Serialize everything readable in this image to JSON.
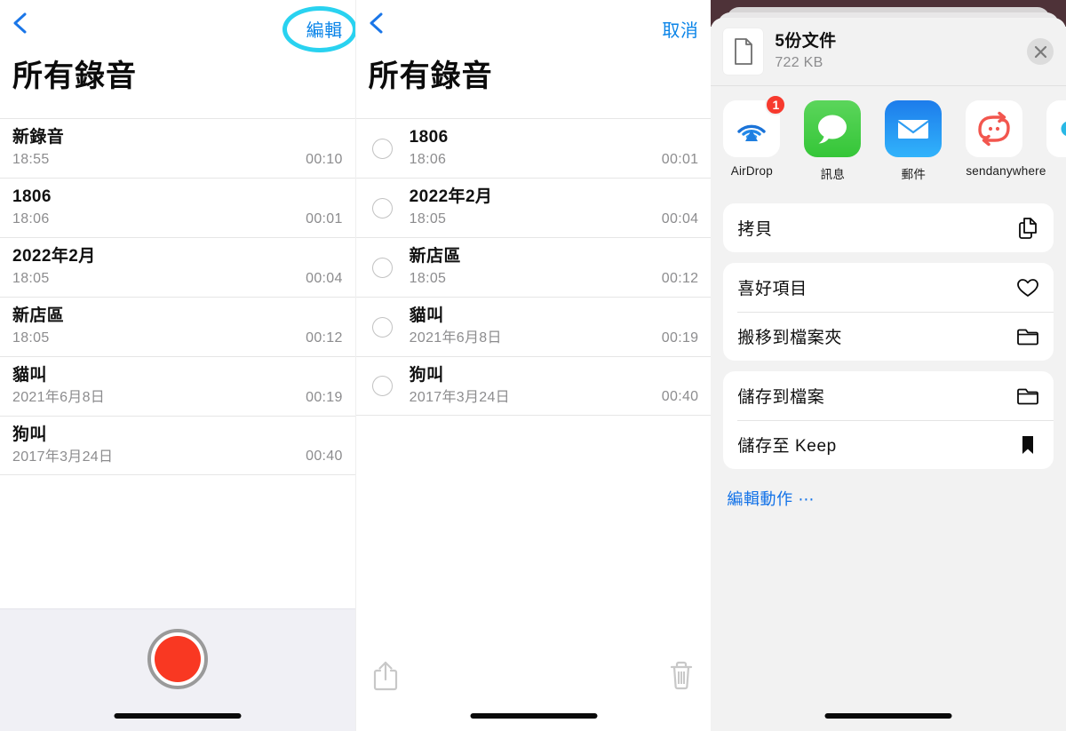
{
  "panel1": {
    "nav": {
      "back_icon": "chevron-left-icon",
      "edit_label": "編輯"
    },
    "title": "所有錄音",
    "recordings": [
      {
        "name": "新錄音",
        "date": "18:55",
        "duration": "00:10"
      },
      {
        "name": "1806",
        "date": "18:06",
        "duration": "00:01"
      },
      {
        "name": "2022年2月",
        "date": "18:05",
        "duration": "00:04"
      },
      {
        "name": "新店區",
        "date": "18:05",
        "duration": "00:12"
      },
      {
        "name": "貓叫",
        "date": "2021年6月8日",
        "duration": "00:19"
      },
      {
        "name": "狗叫",
        "date": "2017年3月24日",
        "duration": "00:40"
      }
    ],
    "record_button_icon": "record-circle-icon"
  },
  "panel2": {
    "nav": {
      "back_icon": "chevron-left-icon",
      "cancel_label": "取消"
    },
    "title": "所有錄音",
    "recordings": [
      {
        "name": "1806",
        "date": "18:06",
        "duration": "00:01"
      },
      {
        "name": "2022年2月",
        "date": "18:05",
        "duration": "00:04"
      },
      {
        "name": "新店區",
        "date": "18:05",
        "duration": "00:12"
      },
      {
        "name": "貓叫",
        "date": "2021年6月8日",
        "duration": "00:19"
      },
      {
        "name": "狗叫",
        "date": "2017年3月24日",
        "duration": "00:40"
      }
    ],
    "toolbar": {
      "share_icon": "share-up-arrow-icon",
      "trash_icon": "trash-icon"
    }
  },
  "panel3": {
    "header": {
      "doc_icon": "document-icon",
      "title": "5份文件",
      "size": "722 KB",
      "close_icon": "close-x-icon"
    },
    "apps": [
      {
        "label": "AirDrop",
        "icon": "airdrop-icon",
        "badge": "1"
      },
      {
        "label": "訊息",
        "icon": "messages-icon",
        "badge": ""
      },
      {
        "label": "郵件",
        "icon": "mail-icon",
        "badge": ""
      },
      {
        "label": "sendanywhere",
        "icon": "sendanywhere-icon",
        "badge": ""
      },
      {
        "label": "",
        "icon": "flickr-icon",
        "badge": ""
      }
    ],
    "action_groups": [
      {
        "rows": [
          {
            "label": "拷貝",
            "icon": "copy-icon"
          }
        ]
      },
      {
        "rows": [
          {
            "label": "喜好項目",
            "icon": "heart-icon"
          },
          {
            "label": "搬移到檔案夾",
            "icon": "folder-icon"
          }
        ]
      },
      {
        "rows": [
          {
            "label": "儲存到檔案",
            "icon": "folder-icon"
          },
          {
            "label": "儲存至 Keep",
            "icon": "bookmark-icon"
          }
        ]
      }
    ],
    "edit_actions_label": "編輯動作 ⋯"
  },
  "annotations": {
    "color": "#29d2f0",
    "edit_button_highlight": "oval-around-edit-button",
    "select-circles_highlight": "pill-around-selection-circles"
  }
}
